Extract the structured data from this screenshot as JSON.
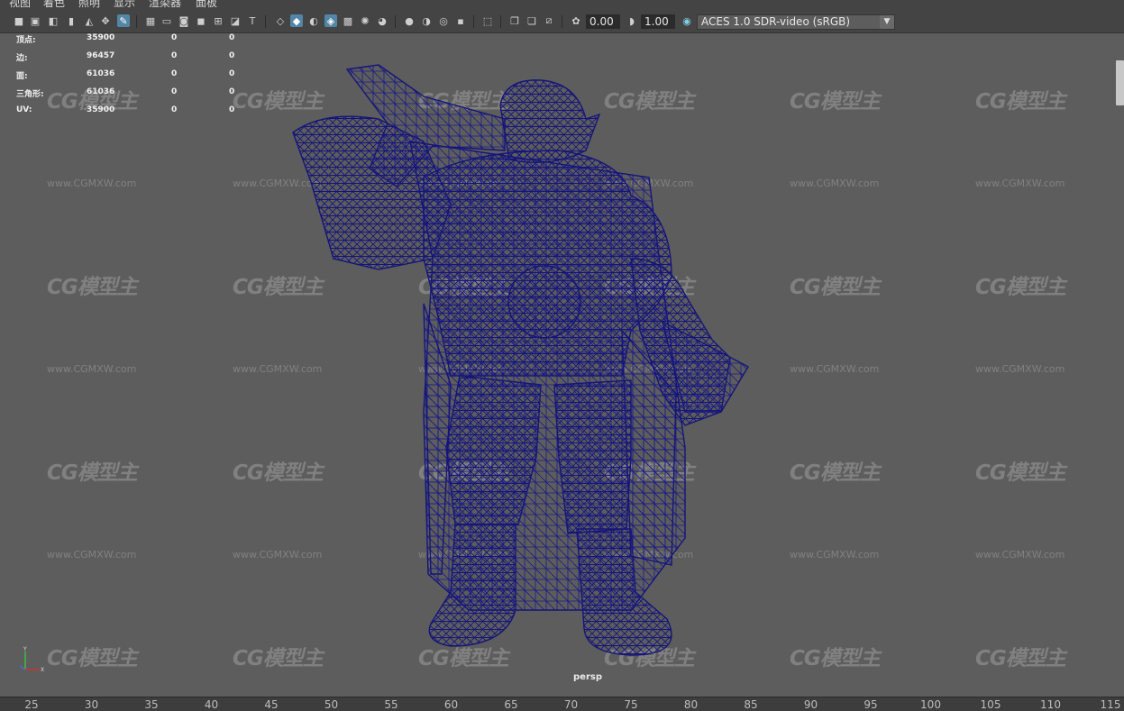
{
  "menu": [
    "视图",
    "着色",
    "照明",
    "显示",
    "渲染器",
    "面板"
  ],
  "toolbar": {
    "exposure_value": "0.00",
    "gamma_value": "1.00",
    "color_space": "ACES 1.0 SDR-video (sRGB)",
    "icons": [
      "camera-icon",
      "camera-lock-icon",
      "camera-attributes-icon",
      "bookmark-icon",
      "image-plane-icon",
      "move-camera-icon",
      "grease-pencil-icon",
      "grid-icon",
      "film-gate-icon",
      "resolution-gate-icon",
      "gate-mask-icon",
      "field-chart-icon",
      "safe-action-icon",
      "safe-title-icon",
      "wireframe-icon",
      "smooth-shade-icon",
      "default-material-icon",
      "wireframe-on-shaded-icon",
      "textured-icon",
      "lights-icon",
      "shadows-icon",
      "screen-space-ao-icon",
      "motion-blur-icon",
      "multisample-aa-icon",
      "depth-of-field-icon",
      "isolate-select-icon",
      "xray-icon",
      "xray-joints-icon",
      "xray-components-icon",
      "backface-culling-icon",
      "exposure-icon",
      "gamma-icon",
      "color-management-icon"
    ]
  },
  "hud": {
    "rows": [
      {
        "label": "顶点:",
        "v1": "35900",
        "v2": "0",
        "v3": "0"
      },
      {
        "label": "边:",
        "v1": "96457",
        "v2": "0",
        "v3": "0"
      },
      {
        "label": "面:",
        "v1": "61036",
        "v2": "0",
        "v3": "0"
      },
      {
        "label": "三角形:",
        "v1": "61036",
        "v2": "0",
        "v3": "0"
      },
      {
        "label": "UV:",
        "v1": "35900",
        "v2": "0",
        "v3": "0"
      }
    ]
  },
  "watermark": {
    "logo": "CG模型主",
    "url": "www.CGMXW.com"
  },
  "viewport": {
    "camera": "persp",
    "wire_color": "#15157a"
  },
  "timeline": {
    "ticks": [
      "25",
      "30",
      "35",
      "40",
      "45",
      "50",
      "55",
      "60",
      "65",
      "70",
      "75",
      "80",
      "85",
      "90",
      "95",
      "100",
      "105",
      "110",
      "115"
    ]
  },
  "colors": {
    "accent": "#5285a6",
    "viewport_bg": "#5d5d5d"
  }
}
